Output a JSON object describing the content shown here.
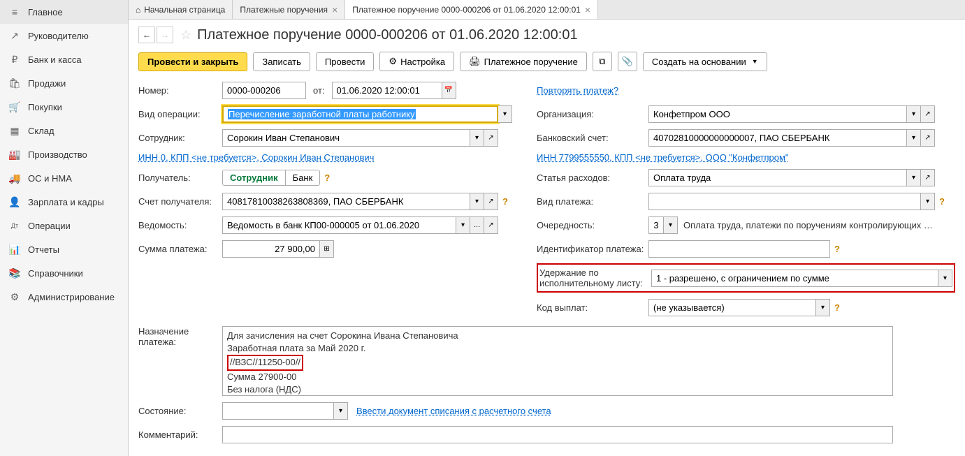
{
  "sidebar": {
    "items": [
      {
        "label": "Главное",
        "icon": "≡"
      },
      {
        "label": "Руководителю",
        "icon": "↗"
      },
      {
        "label": "Банк и касса",
        "icon": "₽"
      },
      {
        "label": "Продажи",
        "icon": "🛍"
      },
      {
        "label": "Покупки",
        "icon": "🛒"
      },
      {
        "label": "Склад",
        "icon": "▦"
      },
      {
        "label": "Производство",
        "icon": "🏭"
      },
      {
        "label": "ОС и НМА",
        "icon": "🚚"
      },
      {
        "label": "Зарплата и кадры",
        "icon": "👤"
      },
      {
        "label": "Операции",
        "icon": "Дт"
      },
      {
        "label": "Отчеты",
        "icon": "📊"
      },
      {
        "label": "Справочники",
        "icon": "📚"
      },
      {
        "label": "Администрирование",
        "icon": "⚙"
      }
    ]
  },
  "tabs": [
    {
      "label": "Начальная страница",
      "close": false,
      "icon": "⌂"
    },
    {
      "label": "Платежные поручения",
      "close": true
    },
    {
      "label": "Платежное поручение 0000-000206 от 01.06.2020 12:00:01",
      "close": true,
      "active": true
    }
  ],
  "title": "Платежное поручение 0000-000206 от 01.06.2020 12:00:01",
  "toolbar": {
    "save_close": "Провести и закрыть",
    "save": "Записать",
    "post": "Провести",
    "settings": "Настройка",
    "print": "Платежное поручение",
    "create_based": "Создать на основании"
  },
  "form": {
    "number_label": "Номер:",
    "number": "0000-000206",
    "date_label": "от:",
    "date": "01.06.2020 12:00:01",
    "repeat_link": "Повторять платеж?",
    "operation_label": "Вид операции:",
    "operation": "Перечисление заработной платы работнику",
    "org_label": "Организация:",
    "org": "Конфетпром ООО",
    "employee_label": "Сотрудник:",
    "employee": "Сорокин Иван Степанович",
    "bank_acc_label": "Банковский счет:",
    "bank_acc": "40702810000000000007, ПАО СБЕРБАНК",
    "inn_left": "ИНН 0, КПП <не требуется>, Сорокин Иван Степанович",
    "inn_right": "ИНН 7799555550, КПП <не требуется>, ООО \"Конфетпром\"",
    "recipient_label": "Получатель:",
    "recipient_opt1": "Сотрудник",
    "recipient_opt2": "Банк",
    "expense_label": "Статья расходов:",
    "expense": "Оплата труда",
    "recipient_acc_label": "Счет получателя:",
    "recipient_acc": "40817810038263808369, ПАО СБЕРБАНК",
    "payment_type_label": "Вид платежа:",
    "payment_type": "",
    "vedomost_label": "Ведомость:",
    "vedomost": "Ведомость в банк КП00-000005 от 01.06.2020",
    "priority_label": "Очередность:",
    "priority": "3",
    "priority_text": "Оплата труда, платежи по поручениям контролирующих орга...",
    "amount_label": "Сумма платежа:",
    "amount": "27 900,00",
    "payment_id_label": "Идентификатор платежа:",
    "withhold_label": "Удержание по исполнительному листу:",
    "withhold": "1 - разрешено, с ограничением по сумме",
    "payments_code_label": "Код выплат:",
    "payments_code": "(не указывается)",
    "purpose_label": "Назначение платежа:",
    "purpose_l1": "Для зачисления на счет Сорокина Ивана Степановича",
    "purpose_l2": "Заработная плата за Май 2020 г.",
    "purpose_l3": "//ВЗС//11250-00//",
    "purpose_l4": "Сумма 27900-00",
    "purpose_l5": "Без налога (НДС)",
    "status_label": "Состояние:",
    "status_link": "Ввести документ списания с расчетного счета",
    "comment_label": "Комментарий:"
  }
}
